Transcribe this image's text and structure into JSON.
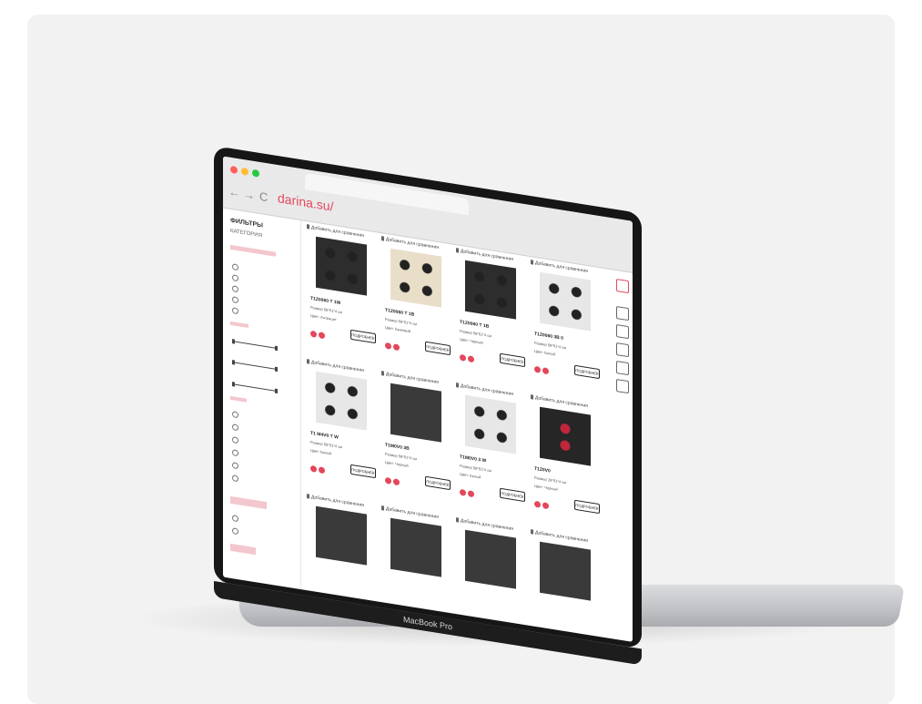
{
  "device": {
    "brand_label": "MacBook Pro"
  },
  "browser": {
    "url": "darina.su/",
    "back_glyph": "←",
    "forward_glyph": "→",
    "reload_glyph": "C",
    "traffic_lights": [
      "#ff5f57",
      "#febc2e",
      "#28c840"
    ]
  },
  "sidebar": {
    "title": "ФИЛЬТРЫ",
    "subtitle": "КАТЕГОРИЯ"
  },
  "products": [
    {
      "compare_label": "Добавить для сравнения",
      "name": "T1Z0060 T 1W",
      "lines": [
        "Размер 58*51*4 см",
        "Цвет: Антрацит"
      ],
      "buy_label": "ПОДРОБНЕЕ",
      "thumb_style": "dark"
    },
    {
      "compare_label": "Добавить для сравнения",
      "name": "T1Z0060 T 1B",
      "lines": [
        "Размер 58*51*4 см",
        "Цвет: Бежевый"
      ],
      "buy_label": "ПОДРОБНЕЕ",
      "thumb_style": "beige"
    },
    {
      "compare_label": "Добавить для сравнения",
      "name": "T1Z0060 T 1B",
      "lines": [
        "Размер 58*51*4 см",
        "Цвет: Черный"
      ],
      "buy_label": "ПОДРОБНЕЕ",
      "thumb_style": "dark"
    },
    {
      "compare_label": "Добавить для сравнения",
      "name": "T1Z0060 3B 0",
      "lines": [
        "Размер 58*51*4 см",
        "Цвет: Белый"
      ],
      "buy_label": "ПОДРОБНЕЕ",
      "thumb_style": "white"
    },
    {
      "compare_label": "Добавить для сравнения",
      "name": "T1 M4V0 T W",
      "lines": [
        "Размер 58*51*4 см",
        "Цвет: Белый"
      ],
      "buy_label": "ПОДРОБНЕЕ",
      "thumb_style": "white"
    },
    {
      "compare_label": "Добавить для сравнения",
      "name": "T1M0V0 3B",
      "lines": [
        "Размер 58*51*4 см",
        "Цвет: Черный"
      ],
      "buy_label": "ПОДРОБНЕЕ",
      "thumb_style": "glass"
    },
    {
      "compare_label": "Добавить для сравнения",
      "name": "T1M0V0 3 W",
      "lines": [
        "Размер 58*51*4 см",
        "Цвет: Белый"
      ],
      "buy_label": "ПОДРОБНЕЕ",
      "thumb_style": "white"
    },
    {
      "compare_label": "Добавить для сравнения",
      "name": "T1Z0V0",
      "lines": [
        "Размер 28*51*4 см",
        "Цвет: Черный"
      ],
      "buy_label": "ПОДРОБНЕЕ",
      "thumb_style": "induction"
    },
    {
      "compare_label": "Добавить для сравнения",
      "thumb_style": "glass"
    },
    {
      "compare_label": "Добавить для сравнения",
      "thumb_style": "glass"
    },
    {
      "compare_label": "Добавить для сравнения",
      "thumb_style": "glass"
    },
    {
      "compare_label": "Добавить для сравнения",
      "thumb_style": "glass"
    }
  ],
  "colors": {
    "accent": "#e4475b",
    "dark": "#2a2a2a"
  }
}
